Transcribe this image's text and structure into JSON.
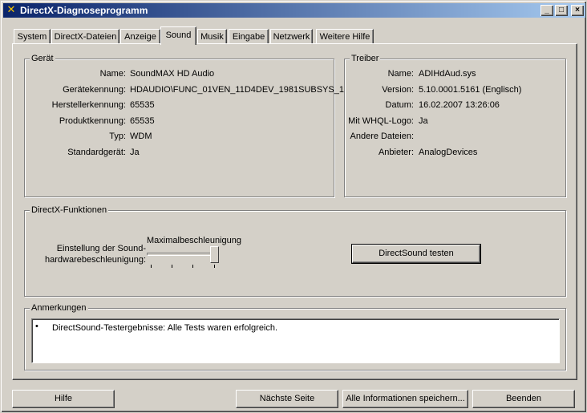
{
  "window": {
    "title": "DirectX-Diagnoseprogramm"
  },
  "tabs": [
    "System",
    "DirectX-Dateien",
    "Anzeige",
    "Sound",
    "Musik",
    "Eingabe",
    "Netzwerk",
    "Weitere Hilfe"
  ],
  "active_tab": "Sound",
  "device": {
    "legend": "Gerät",
    "fields": [
      {
        "label": "Name:",
        "value": "SoundMAX HD Audio"
      },
      {
        "label": "Gerätekennung:",
        "value": "HDAUDIO\\FUNC_01VEN_11D4DEV_1981SUBSYS_1"
      },
      {
        "label": "Herstellerkennung:",
        "value": "65535"
      },
      {
        "label": "Produktkennung:",
        "value": "65535"
      },
      {
        "label": "Typ:",
        "value": "WDM"
      },
      {
        "label": "Standardgerät:",
        "value": "Ja"
      }
    ]
  },
  "driver": {
    "legend": "Treiber",
    "fields": [
      {
        "label": "Name:",
        "value": "ADIHdAud.sys"
      },
      {
        "label": "Version:",
        "value": "5.10.0001.5161 (Englisch)"
      },
      {
        "label": "Datum:",
        "value": "16.02.2007 13:26:06"
      },
      {
        "label": "Mit WHQL-Logo:",
        "value": "Ja"
      },
      {
        "label": "Andere Dateien:",
        "value": ""
      },
      {
        "label": "Anbieter:",
        "value": "AnalogDevices"
      }
    ]
  },
  "directx_features": {
    "legend": "DirectX-Funktionen",
    "accel_label_line1": "Einstellung der Sound-",
    "accel_label_line2": "hardwarebeschleunigung:",
    "accel_value": "Maximalbeschleunigung",
    "accel_level": 1.0,
    "test_button": "DirectSound testen"
  },
  "notes": {
    "legend": "Anmerkungen",
    "items": [
      "DirectSound-Testergebnisse: Alle Tests waren erfolgreich."
    ]
  },
  "footer": {
    "help": "Hilfe",
    "next_page": "Nächste Seite",
    "save_all": "Alle Informationen speichern...",
    "exit": "Beenden"
  },
  "titlebar_buttons": {
    "minimize": "_",
    "maximize": "□",
    "close": "×"
  }
}
